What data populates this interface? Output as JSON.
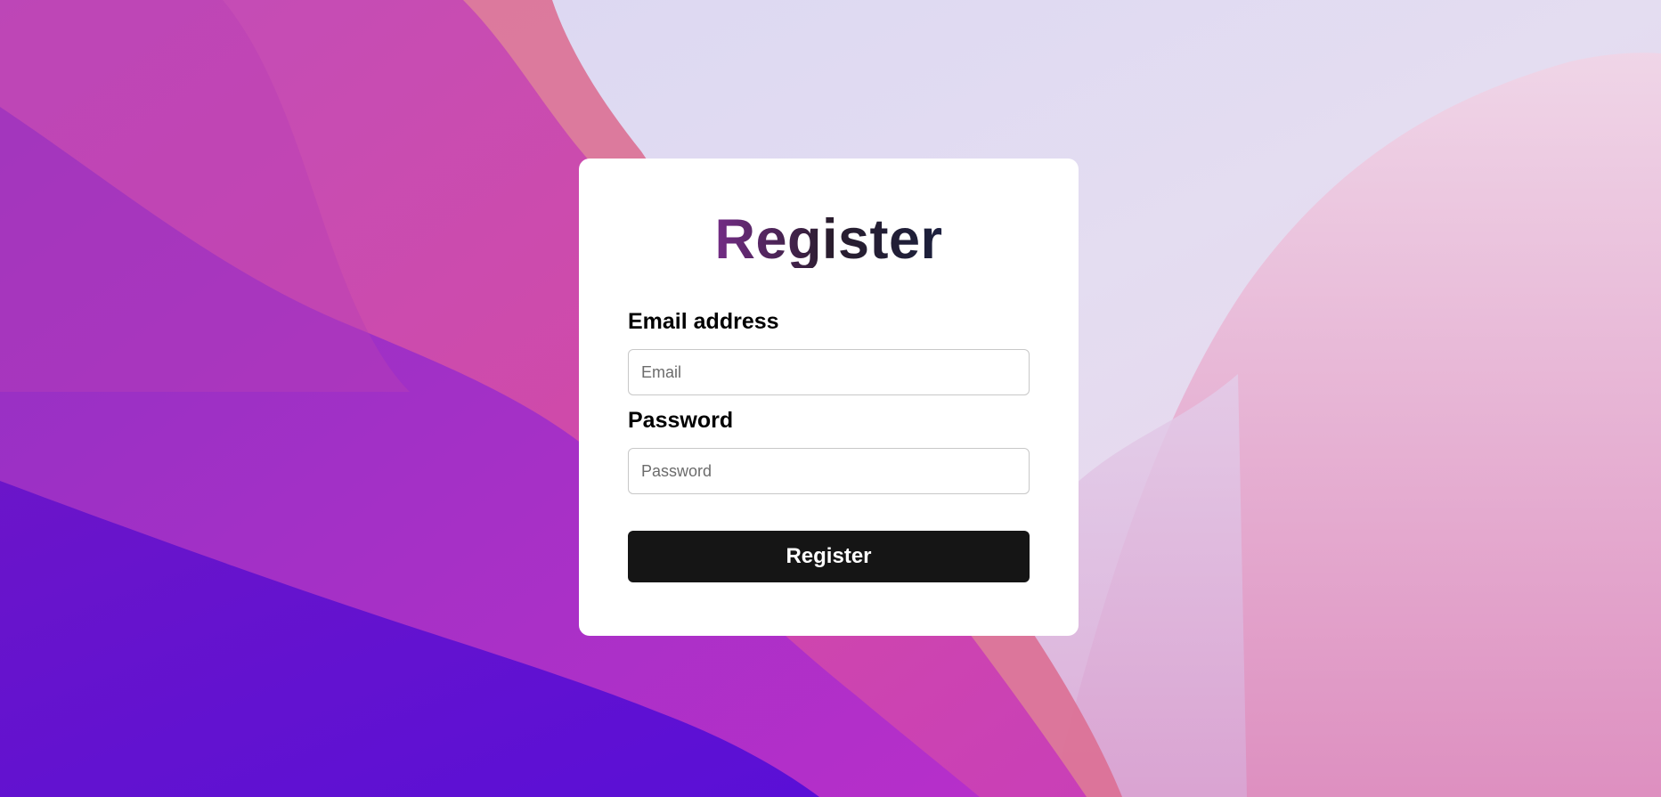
{
  "page": {
    "title": "Register"
  },
  "form": {
    "email_label": "Email address",
    "email_placeholder": "Email",
    "email_value": "",
    "password_label": "Password",
    "password_placeholder": "Password",
    "password_value": "",
    "submit_label": "Register"
  },
  "colors": {
    "button_background": "#151515",
    "card_background": "#ffffff",
    "title_gradient": [
      "#9a3ab8",
      "#2a1d2e",
      "#2b3c8a"
    ]
  }
}
